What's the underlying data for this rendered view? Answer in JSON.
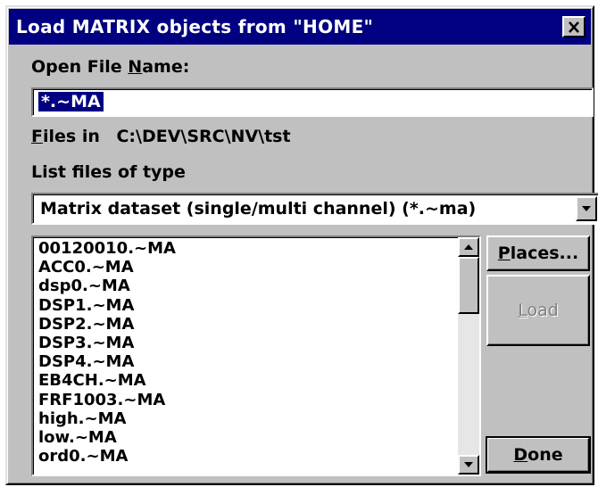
{
  "dialog": {
    "title": "Load MATRIX objects from \"HOME\"",
    "close_label": "×"
  },
  "open_file": {
    "label_pre": "Open File ",
    "label_ul": "N",
    "label_post": "ame:",
    "value": "*.~MA"
  },
  "files_in": {
    "label_ul": "F",
    "label_post": "iles in",
    "path": "C:\\DEV\\SRC\\NV\\tst"
  },
  "file_type": {
    "label": "List files of type",
    "selected": "Matrix dataset  (single/multi channel)  (*.~ma)"
  },
  "files": [
    "00120010.~MA",
    "ACC0.~MA",
    "dsp0.~MA",
    "DSP1.~MA",
    "DSP2.~MA",
    "DSP3.~MA",
    "DSP4.~MA",
    "EB4CH.~MA",
    "FRF1003.~MA",
    "high.~MA",
    "low.~MA",
    "ord0.~MA"
  ],
  "buttons": {
    "places_ul": "P",
    "places_post": "laces...",
    "load_ul": "L",
    "load_post": "oad",
    "done_ul": "D",
    "done_post": "one"
  },
  "scrollbar": {
    "position": 0.0
  }
}
